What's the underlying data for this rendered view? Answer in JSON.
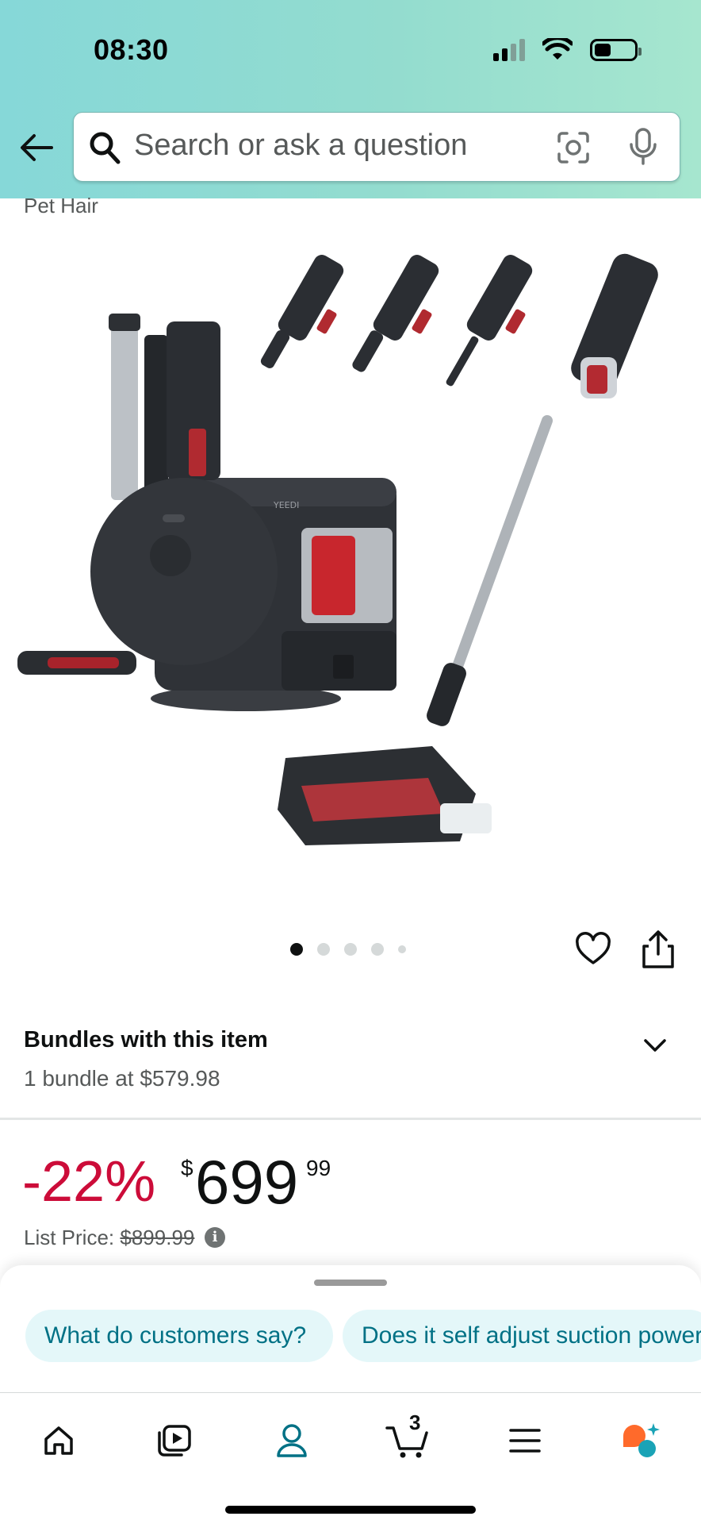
{
  "status_bar": {
    "time": "08:30"
  },
  "search": {
    "placeholder": "Search or ask a question"
  },
  "breadcrumb_tail": "Pet Hair",
  "product_image": {
    "brand_mark": "YEEDI"
  },
  "carousel": {
    "total_images": 5,
    "active_index": 0
  },
  "bundles": {
    "title": "Bundles with this item",
    "subtitle": "1 bundle at $579.98"
  },
  "price": {
    "discount": "-22%",
    "currency_symbol": "$",
    "whole": "699",
    "fraction": "99",
    "list_price_label": "List Price:",
    "list_price_value": "$899.99"
  },
  "suggestions": [
    {
      "label": "What do customers say?"
    },
    {
      "label": "Does it self adjust suction power?"
    }
  ],
  "bottom_nav": {
    "items": [
      "home-icon",
      "video-icon",
      "account-icon",
      "cart-icon",
      "menu-icon",
      "rufus-icon"
    ],
    "active": "account-icon",
    "cart_count": "3"
  },
  "colors": {
    "accent_teal": "#007185",
    "discount_red": "#cc0c39",
    "rufus_orange": "#ff6a2b"
  }
}
